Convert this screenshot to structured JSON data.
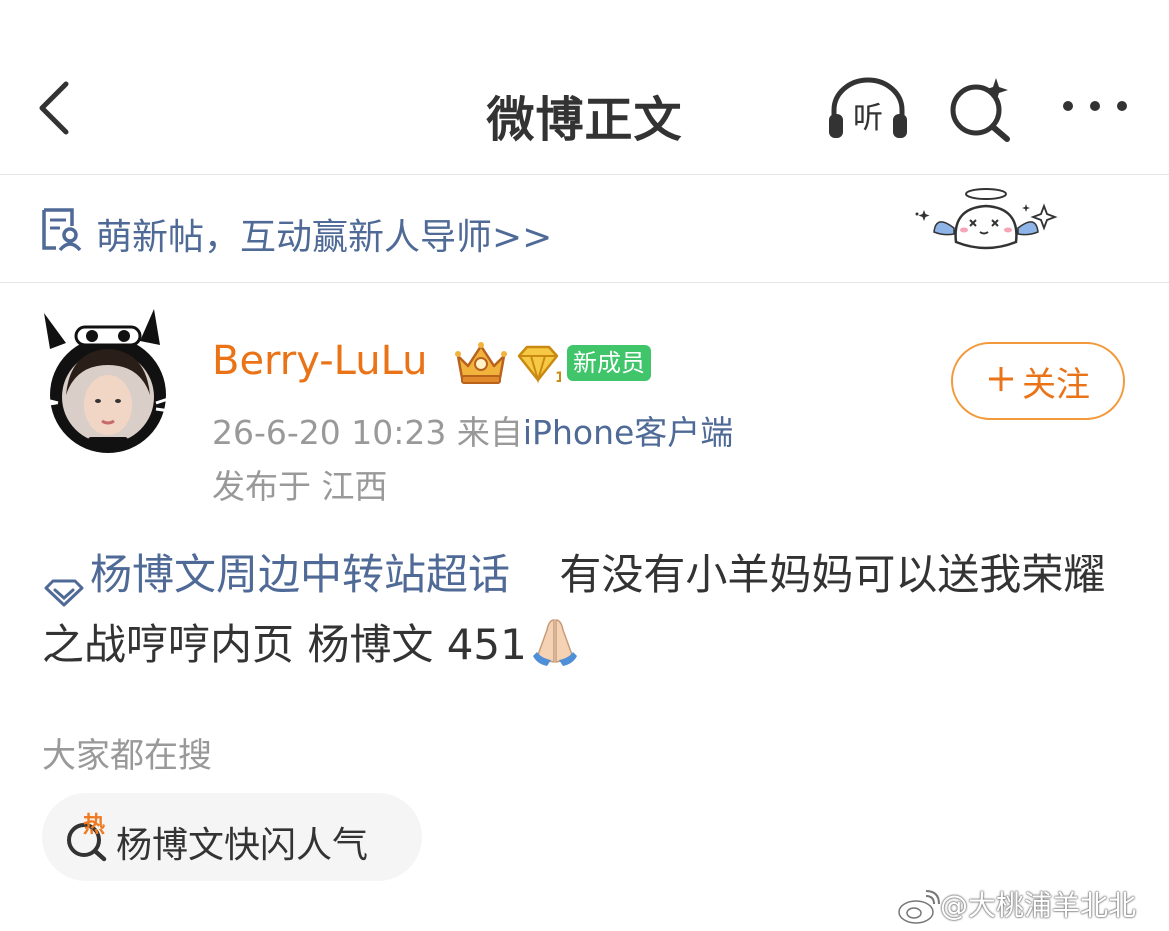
{
  "header": {
    "title": "微博正文",
    "listen_label": "听"
  },
  "banner": {
    "text": "萌新帖，互动赢新人导师>>"
  },
  "post": {
    "username": "Berry-LuLu",
    "member_badge": "新成员",
    "time": "26-6-20 10:23",
    "from_prefix": "来自",
    "client": "iPhone客户端",
    "location": "发布于 江西",
    "follow_label": "关注",
    "topic": "杨博文周边中转站超话",
    "text": "有没有小羊妈妈可以送我荣耀之战哼哼内页 杨博文 451"
  },
  "search": {
    "heading": "大家都在搜",
    "hot_icon_label": "热",
    "hot_term": "杨博文快闪人气"
  },
  "watermark": {
    "text": "@大桃浦羊北北"
  },
  "colors": {
    "accent_orange": "#eb7317",
    "link_blue": "#4f6a96",
    "badge_green": "#40c56b",
    "meta_gray": "#999999"
  }
}
